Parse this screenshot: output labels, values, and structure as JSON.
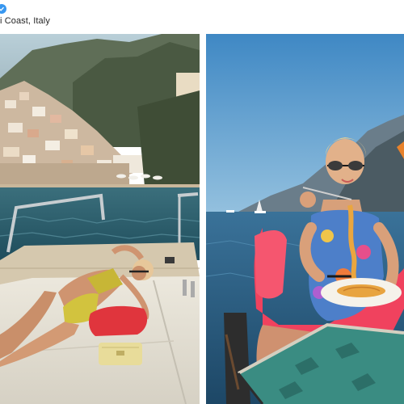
{
  "post": {
    "location": "i Coast, Italy",
    "verified_badge": "verified-icon"
  },
  "photos": [
    {
      "name": "photo-boat-sunbathing",
      "description_icon": "image",
      "palette": {
        "sky": "#a9c3cf",
        "mountain": "#52614a",
        "sea": "#2f5f6e",
        "deck": "#d8cdb7",
        "cushion": "#e9e4d8",
        "swimsuit": "#d8c23c",
        "towel": "#e0353d"
      }
    },
    {
      "name": "photo-pasta-lunch",
      "description_icon": "image",
      "palette": {
        "sky": "#4f93c9",
        "sea": "#2d5f86",
        "kimono": "#f0425e",
        "swimsuit": "#4c7cc8",
        "plate": "#f5f2ea",
        "pasta": "#e8a440",
        "table": "#3d8c83"
      }
    }
  ]
}
